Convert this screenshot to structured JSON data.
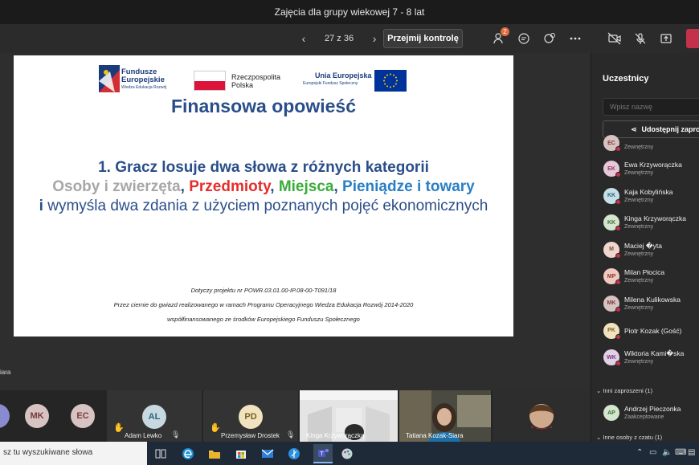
{
  "window": {
    "title": "Zajęcia dla grupy wiekowej 7 - 8 lat"
  },
  "toolbar": {
    "page_counter": "27 z 36",
    "prev_label": "‹",
    "next_label": "›",
    "take_control_label": "Przejmij kontrolę",
    "participants_badge": "2",
    "icons": [
      "people-icon",
      "chat-icon",
      "reactions-icon",
      "more-icon",
      "camera-off-icon",
      "mic-off-icon",
      "share-icon",
      "leave-icon"
    ]
  },
  "slide": {
    "logos": {
      "fe_line1": "Fundusze",
      "fe_line2": "Europejskie",
      "fe_sub": "Wiedza Edukacja Rozwój",
      "pl_line1": "Rzeczpospolita",
      "pl_line2": "Polska",
      "eu_line1": "Unia Europejska",
      "eu_sub": "Europejski Fundusz Społeczny"
    },
    "title": "Finansowa opowieść",
    "heading": "1. Gracz losuje dwa słowa z różnych kategorii",
    "cat_people": "Osoby i zwierzęta",
    "sep1": ", ",
    "cat_items": "Przedmioty",
    "sep2": ", ",
    "cat_places": "Miejsca",
    "sep3": ", ",
    "cat_money": "Pieniądze i towary",
    "line_i": "i",
    "line_rest": " wymyśla dwa zdania z użyciem poznanych pojęć ekonomicznych",
    "foot1": "Dotyczy projektu nr POWR.03.01.00-IP.08-00-T091/18",
    "foot2": "Przez ciernie do gwiazd realizowanego w ramach Programu Operacyjnego Wiedza Edukacja Rozwój 2014-2020",
    "foot3": "współfinansowanego ze środków Europejskiego Funduszu Społecznego"
  },
  "stage": {
    "presenter_label": "iara"
  },
  "strip": {
    "tiles": [
      {
        "initials": "MK",
        "color": "#d8c3c3"
      },
      {
        "initials": "EC",
        "color": "#d8c3c3"
      },
      {
        "initials": "AL",
        "name": "Adam Lewko",
        "color": "#c7d8e0"
      },
      {
        "initials": "PD",
        "name": "Przemysław Drostek",
        "color": "#f2e3c0"
      },
      {
        "name": "Kinga Krzyworączka"
      },
      {
        "name": "Tatiana Kozak-Siara"
      }
    ]
  },
  "panel": {
    "title": "Uczestnicy",
    "search_placeholder": "Wpisz nazwę",
    "share_label": "Udostępnij zapro",
    "participants": [
      {
        "initials": "EC",
        "name": "",
        "sub": "Zewnętrzny",
        "color": "#d8c3c3",
        "fg": "#7a3b3b"
      },
      {
        "initials": "EK",
        "name": "Ewa Krzyworączka",
        "sub": "Zewnętrzny",
        "color": "#e8c8d8",
        "fg": "#8a3b62"
      },
      {
        "initials": "KK",
        "name": "Kaja Kobylińska",
        "sub": "Zewnętrzny",
        "color": "#c7e0e8",
        "fg": "#2b6478"
      },
      {
        "initials": "KK",
        "name": "Kinga Krzyworączka",
        "sub": "Zewnętrzny",
        "color": "#d5e6cf",
        "fg": "#3e6b34"
      },
      {
        "initials": "M",
        "name": "Maciej �yta",
        "sub": "Zewnętrzny",
        "color": "#efd6cf",
        "fg": "#7a4a3b"
      },
      {
        "initials": "MP",
        "name": "Milan Płocica",
        "sub": "Zewnętrzny",
        "color": "#f0c9c0",
        "fg": "#8a3b2b"
      },
      {
        "initials": "MK",
        "name": "Milena Kulikowska",
        "sub": "Zewnętrzny",
        "color": "#d8c3c3",
        "fg": "#7a3b3b"
      },
      {
        "initials": "PK",
        "name": "Piotr Kozak (Gość)",
        "sub": "",
        "color": "#f2e3c0",
        "fg": "#7a6024"
      },
      {
        "initials": "WK",
        "name": "Wiktoria Kami�ska",
        "sub": "Zewnętrzny",
        "color": "#e3cfe6",
        "fg": "#6b3b7a"
      }
    ],
    "invited_section": "Inni zaproszeni (1)",
    "invited": {
      "initials": "AP",
      "name": "Andrzej Pieczonka",
      "sub": "Zaakceptowane",
      "color": "#d5e6cf",
      "fg": "#3e6b34"
    },
    "chat_section": "Inne osoby z czatu (1)"
  },
  "taskbar": {
    "search_text": "sz tu wyszukiwane słowa"
  },
  "colors": {
    "accent": "#6264a7",
    "leave": "#c4314b",
    "title_blue": "#2a4e8a"
  }
}
